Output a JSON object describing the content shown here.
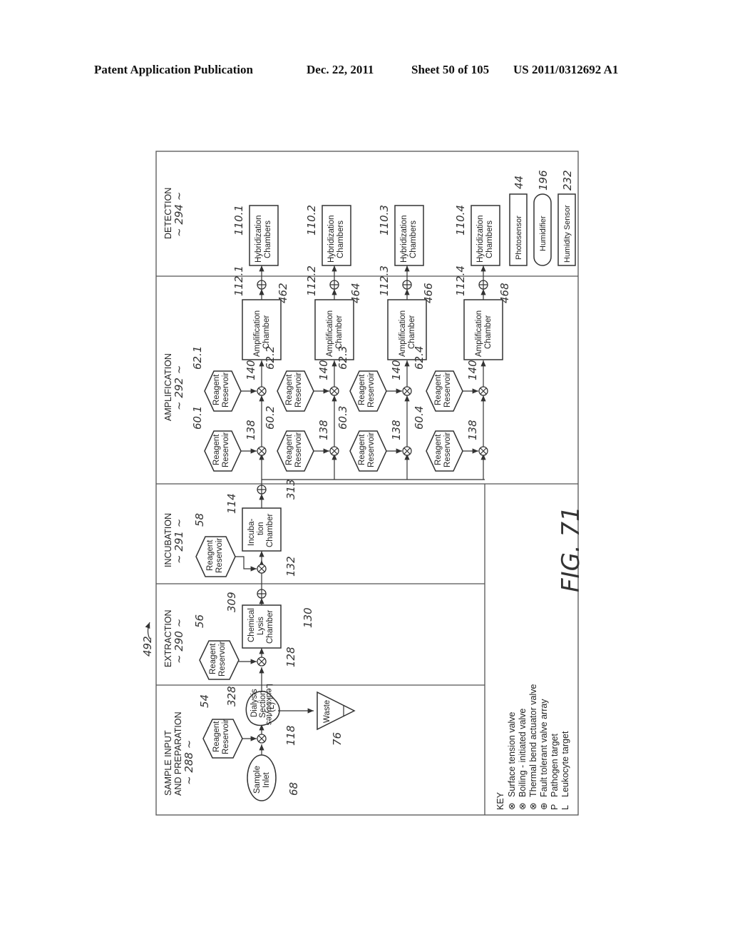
{
  "header": {
    "publication": "Patent Application Publication",
    "date": "Dec. 22, 2011",
    "sheet": "Sheet 50 of 105",
    "number": "US 2011/0312692 A1"
  },
  "figure": {
    "label": "FIG. 71",
    "ref": "492"
  },
  "sections": [
    {
      "title1": "SAMPLE INPUT",
      "title2": "AND PREPARATION",
      "ref": "~ 288 ~"
    },
    {
      "title1": "EXTRACTION",
      "ref": "~ 290 ~"
    },
    {
      "title1": "INCUBATION",
      "ref": "~ 291 ~"
    },
    {
      "title1": "AMPLIFICATION",
      "ref": "~ 292 ~"
    },
    {
      "title1": "DETECTION",
      "ref": "~ 294 ~"
    }
  ],
  "components": {
    "sample_inlet": {
      "l1": "Sample",
      "l2": "Inlet",
      "ref": "68"
    },
    "reservoir_54": {
      "l1": "Reagent",
      "l2": "Reservoir",
      "ref": "54"
    },
    "valve_118": {
      "ref": "118"
    },
    "dialysis": {
      "l1": "Dialysis",
      "l2": "Section",
      "l3": "(L)",
      "ref": "328"
    },
    "waste": {
      "l1": "Waste",
      "ref": "76"
    },
    "leukocytes_label": "Leukocytes",
    "reservoir_56": {
      "l1": "Reagent",
      "l2": "Reservoir",
      "ref": "56"
    },
    "valve_128": {
      "ref": "128"
    },
    "lysis": {
      "l1": "Chemical",
      "l2": "Lysis",
      "l3": "Chamber",
      "ref": "130"
    },
    "valve_309": {
      "ref": "309"
    },
    "reservoir_58": {
      "l1": "Reagent",
      "l2": "Reservoir",
      "ref": "58"
    },
    "valve_132": {
      "ref": "132"
    },
    "incubation": {
      "l1": "Incuba-",
      "l2": "tion",
      "l3": "Chamber",
      "ref": "114"
    },
    "valve_313": {
      "ref": "313"
    },
    "reservoir_label": {
      "l1": "Reagent",
      "l2": "Reservoir"
    },
    "amp_label": {
      "l1": "Amplification",
      "l2": "Chamber"
    },
    "hyb_label": {
      "l1": "Hybridization",
      "l2": "Chambers"
    },
    "valve_138": "138",
    "valve_140": "140",
    "lanes": [
      {
        "res_a": "60.1",
        "res_b": "62.1",
        "amp": "112.1",
        "valve": "462",
        "hyb": "110.1"
      },
      {
        "res_a": "60.2",
        "res_b": "62.2",
        "amp": "112.2",
        "valve": "464",
        "hyb": "110.2"
      },
      {
        "res_a": "60.3",
        "res_b": "62.3",
        "amp": "112.3",
        "valve": "466",
        "hyb": "110.3"
      },
      {
        "res_a": "60.4",
        "res_b": "62.4",
        "amp": "112.4",
        "valve": "468",
        "hyb": "110.4"
      }
    ],
    "photosensor": {
      "label": "Photosensor",
      "ref": "44"
    },
    "humidifier": {
      "label": "Humidifier",
      "ref": "196"
    },
    "humidity_sensor": {
      "label": "Humidity Sensor",
      "ref": "232"
    }
  },
  "key": {
    "title": "KEY",
    "items": [
      {
        "symbol": "⊗",
        "label": "Surface tension valve"
      },
      {
        "symbol": "⊗",
        "label": "Boiling - initiated valve"
      },
      {
        "symbol": "⊗",
        "label": "Thermal bend actuator valve"
      },
      {
        "symbol": "⊕",
        "label": "Fault tolerant valve array"
      },
      {
        "symbol": "P",
        "label": "Pathogen target"
      },
      {
        "symbol": "L",
        "label": "Leukocyte target"
      }
    ]
  }
}
